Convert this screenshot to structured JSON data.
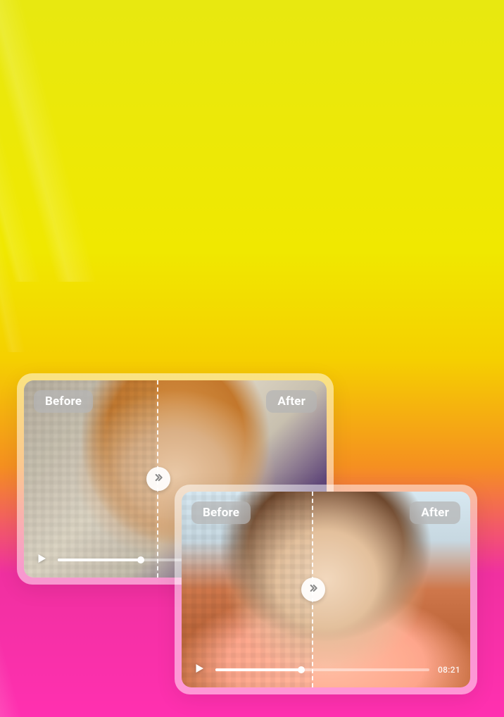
{
  "colors": {
    "bg_top": "#e8e810",
    "bg_mid": "#f59020",
    "bg_bottom": "#ff30b0",
    "pill_bg": "rgba(180,180,180,0.72)",
    "pill_text": "#ffffff"
  },
  "cards": [
    {
      "before_label": "Before",
      "after_label": "After",
      "timestamp": "",
      "has_timestamp": false,
      "progress_pct": 32,
      "divider_pct": 44
    },
    {
      "before_label": "Before",
      "after_label": "After",
      "timestamp": "08:21",
      "has_timestamp": true,
      "progress_pct": 40,
      "divider_pct": 45
    }
  ]
}
